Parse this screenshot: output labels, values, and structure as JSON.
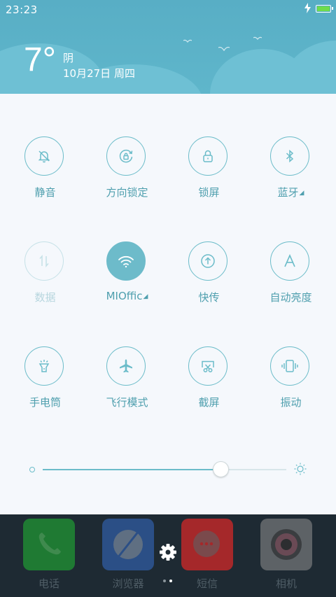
{
  "status_bar": {
    "time": "23:23"
  },
  "weather": {
    "temperature": "7°",
    "condition": "阴",
    "date": "10月27日 周四"
  },
  "toggles": [
    {
      "label": "静音",
      "icon": "bell-off-icon",
      "state": "off"
    },
    {
      "label": "方向锁定",
      "icon": "rotation-lock-icon",
      "state": "off"
    },
    {
      "label": "锁屏",
      "icon": "lock-icon",
      "state": "off"
    },
    {
      "label": "蓝牙",
      "icon": "bluetooth-icon",
      "state": "off",
      "has_more": true
    },
    {
      "label": "数据",
      "icon": "mobile-data-icon",
      "state": "disabled"
    },
    {
      "label": "MIOffic",
      "icon": "wifi-icon",
      "state": "on",
      "has_more": true
    },
    {
      "label": "快传",
      "icon": "quick-transfer-icon",
      "state": "off"
    },
    {
      "label": "自动亮度",
      "icon": "auto-brightness-icon",
      "state": "off"
    },
    {
      "label": "手电筒",
      "icon": "flashlight-icon",
      "state": "off"
    },
    {
      "label": "飞行模式",
      "icon": "airplane-icon",
      "state": "off"
    },
    {
      "label": "截屏",
      "icon": "screenshot-icon",
      "state": "off"
    },
    {
      "label": "振动",
      "icon": "vibrate-icon",
      "state": "off"
    }
  ],
  "brightness": {
    "level": 0.73
  },
  "dock": {
    "apps": [
      {
        "label": "电话",
        "icon": "phone-icon",
        "color": "#1f7a33"
      },
      {
        "label": "浏览器",
        "icon": "browser-icon",
        "color": "#2b4f86"
      },
      {
        "label": "短信",
        "icon": "messages-icon",
        "color": "#a5282a"
      },
      {
        "label": "相机",
        "icon": "camera-icon",
        "color": "#5d6266"
      }
    ]
  },
  "colors": {
    "accent": "#6bbcc9",
    "header": "#5cb2c8",
    "panel": "#f5f8fc"
  },
  "pager": {
    "pages": 2,
    "current": 1
  }
}
